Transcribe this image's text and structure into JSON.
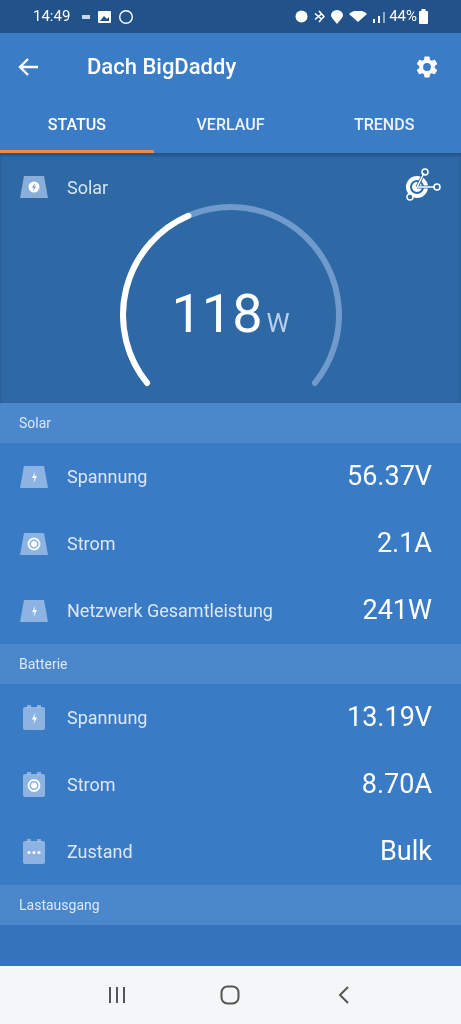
{
  "status_bar": {
    "time": "14:49",
    "battery": "44%"
  },
  "app_bar": {
    "title": "Dach BigDaddy"
  },
  "tabs": [
    {
      "label": "STATUS",
      "selected": true
    },
    {
      "label": "VERLAUF",
      "selected": false
    },
    {
      "label": "TRENDS",
      "selected": false
    }
  ],
  "gauge": {
    "label": "Solar",
    "value": "118",
    "unit": "W"
  },
  "sections": [
    {
      "title": "Solar",
      "kind": "solar",
      "rows": [
        {
          "kind": "voltage",
          "label": "Spannung",
          "value": "56.37V"
        },
        {
          "kind": "current",
          "label": "Strom",
          "value": "2.1A"
        },
        {
          "kind": "voltage",
          "label": "Netzwerk Gesamtleistung",
          "value": "241W"
        }
      ]
    },
    {
      "title": "Batterie",
      "kind": "battery",
      "rows": [
        {
          "kind": "voltage",
          "label": "Spannung",
          "value": "13.19V"
        },
        {
          "kind": "current",
          "label": "Strom",
          "value": "8.70A"
        },
        {
          "kind": "state",
          "label": "Zustand",
          "value": "Bulk"
        }
      ]
    },
    {
      "title": "Lastausgang"
    }
  ]
}
